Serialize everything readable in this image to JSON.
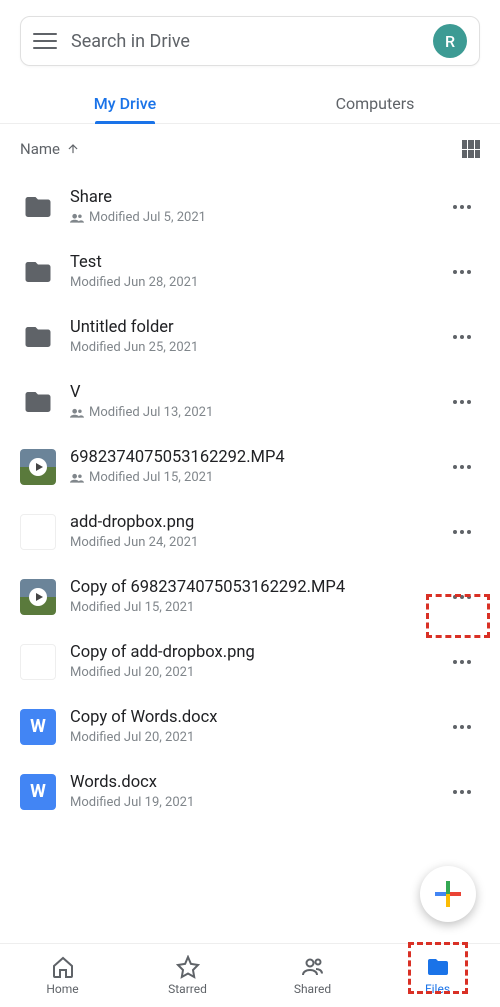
{
  "search": {
    "placeholder": "Search in Drive",
    "avatar_initial": "R"
  },
  "tabs": {
    "drive": "My Drive",
    "computers": "Computers"
  },
  "sort": {
    "label": "Name"
  },
  "files": [
    {
      "name": "Share",
      "meta": "Modified Jul 5, 2021",
      "type": "folder",
      "shared": true
    },
    {
      "name": "Test",
      "meta": "Modified Jun 28, 2021",
      "type": "folder",
      "shared": false
    },
    {
      "name": "Untitled folder",
      "meta": "Modified Jun 25, 2021",
      "type": "folder",
      "shared": false
    },
    {
      "name": "V",
      "meta": "Modified Jul 13, 2021",
      "type": "folder",
      "shared": true
    },
    {
      "name": "6982374075053162292.MP4",
      "meta": "Modified Jul 15, 2021",
      "type": "video",
      "shared": true
    },
    {
      "name": "add-dropbox.png",
      "meta": "Modified Jun 24, 2021",
      "type": "png",
      "shared": false
    },
    {
      "name": "Copy of 6982374075053162292.MP4",
      "meta": "Modified Jul 15, 2021",
      "type": "video",
      "shared": false
    },
    {
      "name": "Copy of add-dropbox.png",
      "meta": "Modified Jul 20, 2021",
      "type": "png",
      "shared": false
    },
    {
      "name": "Copy of Words.docx",
      "meta": "Modified Jul 20, 2021",
      "type": "word",
      "shared": false
    },
    {
      "name": "Words.docx",
      "meta": "Modified Jul 19, 2021",
      "type": "word",
      "shared": false
    }
  ],
  "nav": {
    "home": "Home",
    "starred": "Starred",
    "shared": "Shared",
    "files": "Files"
  }
}
